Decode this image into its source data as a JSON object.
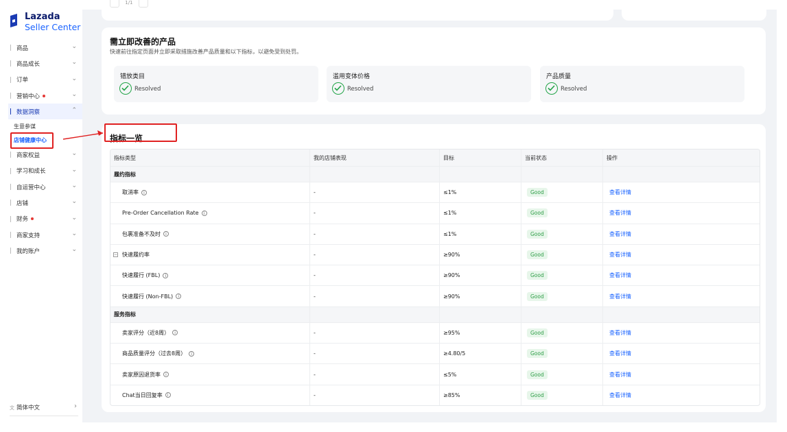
{
  "brand": {
    "line1": "Lazada",
    "line2": "Seller Center",
    "color_dark": "#0a1a6b",
    "color_accent": "#1a63ff"
  },
  "sidebar": {
    "items": [
      {
        "label": "商品",
        "dot": false
      },
      {
        "label": "商品成长",
        "dot": false
      },
      {
        "label": "订单",
        "dot": false
      },
      {
        "label": "营销中心",
        "dot": true
      },
      {
        "label": "数据洞察",
        "dot": false,
        "expanded": true,
        "children": [
          "生意参谋",
          "店铺健康中心"
        ]
      },
      {
        "label": "商家权益",
        "dot": false
      },
      {
        "label": "学习和成长",
        "dot": false
      },
      {
        "label": "自运营中心",
        "dot": false
      },
      {
        "label": "店铺",
        "dot": false
      },
      {
        "label": "财务",
        "dot": true
      },
      {
        "label": "商家支持",
        "dot": false
      },
      {
        "label": "我的账户",
        "dot": false
      }
    ],
    "language": "简体中文"
  },
  "top_pager": {
    "text": "1/1"
  },
  "improve": {
    "title": "需立即改善的产品",
    "desc": "快速前往指定页面并立即采取措施改善产品质量和以下指标，以避免受到处罚。",
    "boxes": [
      {
        "title": "错放类目",
        "status": "Resolved"
      },
      {
        "title": "滥用变体价格",
        "status": "Resolved"
      },
      {
        "title": "产品质量",
        "status": "Resolved"
      }
    ]
  },
  "metrics": {
    "title": "指标一览",
    "headers": [
      "指标类型",
      "我的店铺表现",
      "目标",
      "当前状态",
      "操作"
    ],
    "groups": [
      {
        "label": "履约指标",
        "rows": [
          {
            "name": "取消率",
            "value": "-",
            "target": "≤1%",
            "status": "Good",
            "action": "查看详情"
          },
          {
            "name": "Pre-Order Cancellation Rate",
            "value": "-",
            "target": "≤1%",
            "status": "Good",
            "action": "查看详情"
          },
          {
            "name": "包裹准备不及时",
            "value": "-",
            "target": "≤1%",
            "status": "Good",
            "action": "查看详情"
          },
          {
            "name": "快速履约率",
            "value": "-",
            "target": "≥90%",
            "status": "Good",
            "action": "查看详情",
            "collapsible": true
          },
          {
            "name": "快速履行 (FBL)",
            "value": "-",
            "target": "≥90%",
            "status": "Good",
            "action": "查看详情"
          },
          {
            "name": "快速履行 (Non-FBL)",
            "value": "-",
            "target": "≥90%",
            "status": "Good",
            "action": "查看详情"
          }
        ]
      },
      {
        "label": "服务指标",
        "rows": [
          {
            "name": "卖家评分（近8周）",
            "value": "-",
            "target": "≥95%",
            "status": "Good",
            "action": "查看详情"
          },
          {
            "name": "商品质量评分（过去8周）",
            "value": "-",
            "target": "≥4.80/5",
            "status": "Good",
            "action": "查看详情"
          },
          {
            "name": "卖家原因退货率",
            "value": "-",
            "target": "≤5%",
            "status": "Good",
            "action": "查看详情"
          },
          {
            "name": "Chat当日回复率",
            "value": "-",
            "target": "≥85%",
            "status": "Good",
            "action": "查看详情"
          }
        ]
      }
    ]
  },
  "colors": {
    "good_bg": "#e7f6ea",
    "good_text": "#2f9e48",
    "link": "#1a63ff",
    "annotation": "#e02020",
    "resolved": "#22a447"
  }
}
